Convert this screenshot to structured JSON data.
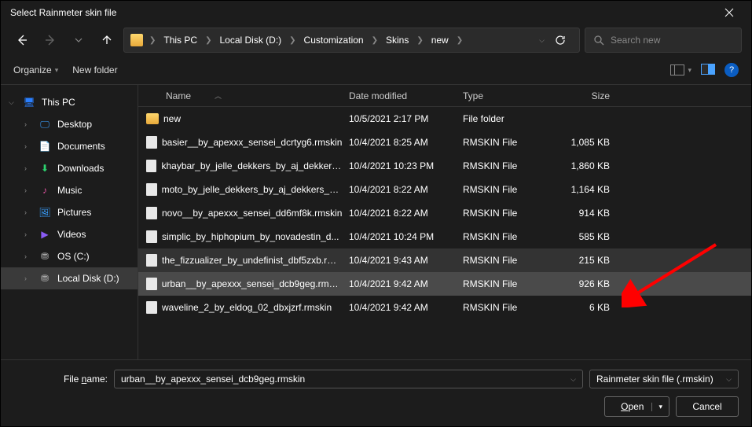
{
  "title": "Select Rainmeter skin file",
  "breadcrumbs": [
    "This PC",
    "Local Disk (D:)",
    "Customization",
    "Skins",
    "new"
  ],
  "search_placeholder": "Search new",
  "toolbar": {
    "organize": "Organize",
    "newfolder": "New folder"
  },
  "columns": {
    "name": "Name",
    "date": "Date modified",
    "type": "Type",
    "size": "Size"
  },
  "sidebar": {
    "thispc": "This PC",
    "items": [
      {
        "label": "Desktop"
      },
      {
        "label": "Documents"
      },
      {
        "label": "Downloads"
      },
      {
        "label": "Music"
      },
      {
        "label": "Pictures"
      },
      {
        "label": "Videos"
      },
      {
        "label": "OS (C:)"
      },
      {
        "label": "Local Disk (D:)"
      }
    ]
  },
  "files": [
    {
      "name": "new",
      "date": "10/5/2021 2:17 PM",
      "type": "File folder",
      "size": "",
      "folder": true
    },
    {
      "name": "basier__by_apexxx_sensei_dcrtyg6.rmskin",
      "date": "10/4/2021 8:25 AM",
      "type": "RMSKIN File",
      "size": "1,085 KB"
    },
    {
      "name": "khaybar_by_jelle_dekkers_by_aj_dekkers_...",
      "date": "10/4/2021 10:23 PM",
      "type": "RMSKIN File",
      "size": "1,860 KB"
    },
    {
      "name": "moto_by_jelle_dekkers_by_aj_dekkers_de...",
      "date": "10/4/2021 8:22 AM",
      "type": "RMSKIN File",
      "size": "1,164 KB"
    },
    {
      "name": "novo__by_apexxx_sensei_dd6mf8k.rmskin",
      "date": "10/4/2021 8:22 AM",
      "type": "RMSKIN File",
      "size": "914 KB"
    },
    {
      "name": "simplic_by_hiphopium_by_novadestin_d...",
      "date": "10/4/2021 10:24 PM",
      "type": "RMSKIN File",
      "size": "585 KB"
    },
    {
      "name": "the_fizzualizer_by_undefinist_dbf5zxb.rm...",
      "date": "10/4/2021 9:43 AM",
      "type": "RMSKIN File",
      "size": "215 KB",
      "hover": true
    },
    {
      "name": "urban__by_apexxx_sensei_dcb9geg.rmskin",
      "date": "10/4/2021 9:42 AM",
      "type": "RMSKIN File",
      "size": "926 KB",
      "selected": true
    },
    {
      "name": "waveline_2_by_eldog_02_dbxjzrf.rmskin",
      "date": "10/4/2021 9:42 AM",
      "type": "RMSKIN File",
      "size": "6 KB"
    }
  ],
  "footer": {
    "filename_label": "File name:",
    "filename_value": "urban__by_apexxx_sensei_dcb9geg.rmskin",
    "filter": "Rainmeter skin file (.rmskin)",
    "open": "Open",
    "cancel": "Cancel"
  }
}
